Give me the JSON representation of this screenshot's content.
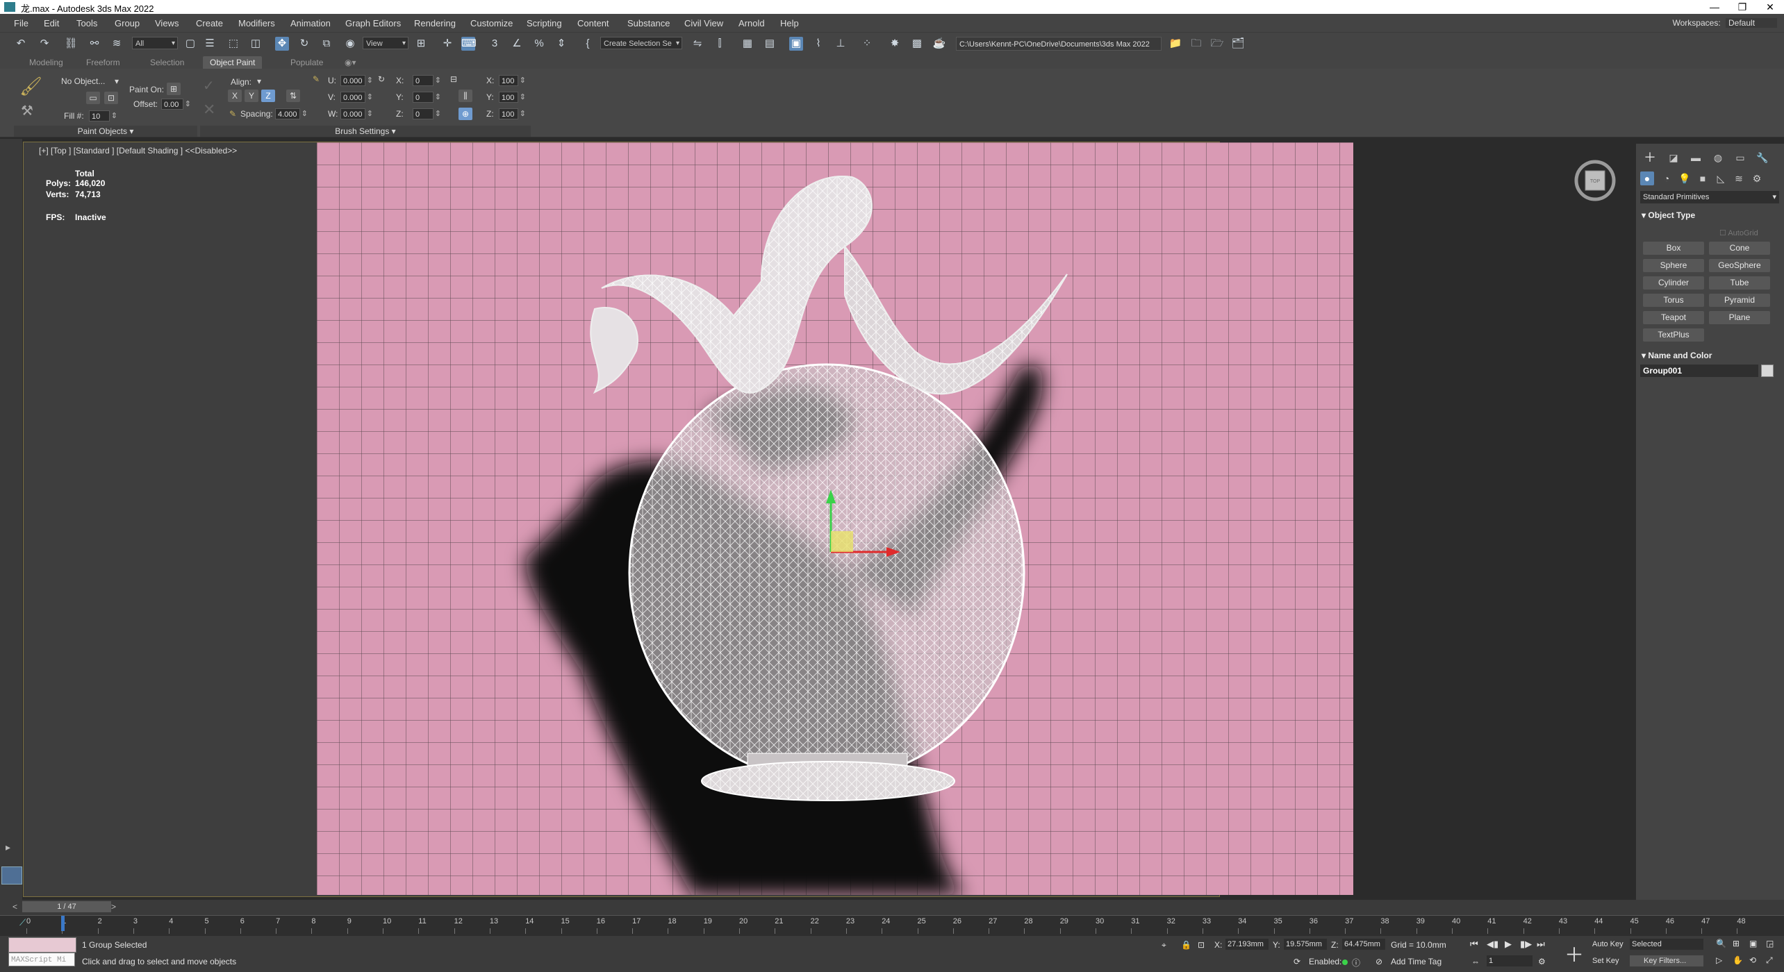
{
  "window": {
    "title": "龙.max - Autodesk 3ds Max 2022",
    "controls": [
      "—",
      "❐",
      "✕"
    ]
  },
  "menu": {
    "items": [
      "File",
      "Edit",
      "Tools",
      "Group",
      "Views",
      "Create",
      "Modifiers",
      "Animation",
      "Graph Editors",
      "Rendering",
      "Customize",
      "Scripting",
      "Content",
      "Substance",
      "Civil View",
      "Arnold",
      "Help"
    ],
    "workspaces_label": "Workspaces:",
    "workspaces_value": "Default"
  },
  "toolbar": {
    "selection_filter": "All",
    "coord_system": "View",
    "named_selection": "Create Selection Se",
    "project_path": "C:\\Users\\Kennt-PC\\OneDrive\\Documents\\3ds Max 2022"
  },
  "ribbon": {
    "tabs": [
      "Modeling",
      "Freeform",
      "Selection",
      "Object Paint",
      "Populate"
    ],
    "active_tab": "Object Paint",
    "paint_objects": {
      "object_dropdown": "No Object...",
      "paint_on_label": "Paint On:",
      "offset_label": "Offset:",
      "offset_value": "0.00",
      "fill_label": "Fill #:",
      "fill_value": "10",
      "footer": "Paint Objects"
    },
    "brush_settings": {
      "align_label": "Align:",
      "axes": [
        "X",
        "Y",
        "Z"
      ],
      "active_axis": "Z",
      "spacing_label": "Spacing:",
      "spacing_value": "4.000",
      "u_label": "U:",
      "u_value": "0.000",
      "v_label": "V:",
      "v_value": "0.000",
      "w_label": "W:",
      "w_value": "0.000",
      "rx_label": "X:",
      "rx_value": "0",
      "ry_label": "Y:",
      "ry_value": "0",
      "rz_label": "Z:",
      "rz_value": "0",
      "sx_label": "X:",
      "sx_value": "100",
      "sy_label": "Y:",
      "sy_value": "100",
      "sz_label": "Z:",
      "sz_value": "100",
      "footer": "Brush Settings"
    }
  },
  "viewport": {
    "label": "[+] [Top ] [Standard ] [Default Shading ]  <<Disabled>>",
    "stats": {
      "total_label": "Total",
      "polys_label": "Polys:",
      "polys_value": "146,020",
      "verts_label": "Verts:",
      "verts_value": "74,713",
      "fps_label": "FPS:",
      "fps_value": "Inactive"
    },
    "background_color": "#d99ab4"
  },
  "command_panel": {
    "category": "Standard Primitives",
    "object_type_header": "Object Type",
    "autogrid": "AutoGrid",
    "buttons": [
      "Box",
      "Cone",
      "Sphere",
      "GeoSphere",
      "Cylinder",
      "Tube",
      "Torus",
      "Pyramid",
      "Teapot",
      "Plane",
      "TextPlus"
    ],
    "name_color_header": "Name and Color",
    "object_name": "Group001"
  },
  "timeline": {
    "frame_display": "1 / 47",
    "ticks": [
      "0",
      "1",
      "2",
      "3",
      "4",
      "5",
      "6",
      "7",
      "8",
      "9",
      "10",
      "11",
      "12",
      "13",
      "14",
      "15",
      "16",
      "17",
      "18",
      "19",
      "20",
      "21",
      "22",
      "23",
      "24",
      "25",
      "26",
      "27",
      "28",
      "29",
      "30",
      "31",
      "32",
      "33",
      "34",
      "35",
      "36",
      "37",
      "38",
      "39",
      "40",
      "41",
      "42",
      "43",
      "44",
      "45",
      "46",
      "47",
      "48"
    ]
  },
  "status": {
    "maxscript": "MAXScript Mi",
    "selected_text": "1 Group Selected",
    "prompt": "Click and drag to select and move objects",
    "x_label": "X:",
    "x_value": "27.193mm",
    "y_label": "Y:",
    "y_value": "19.575mm",
    "z_label": "Z:",
    "z_value": "64.475mm",
    "grid": "Grid = 10.0mm",
    "enabled_label": "Enabled:",
    "add_time_tag": "Add Time Tag",
    "auto_key": "Auto Key",
    "selected_dd": "Selected",
    "set_key": "Set Key",
    "key_filters": "Key Filters...",
    "current_frame": "1"
  }
}
